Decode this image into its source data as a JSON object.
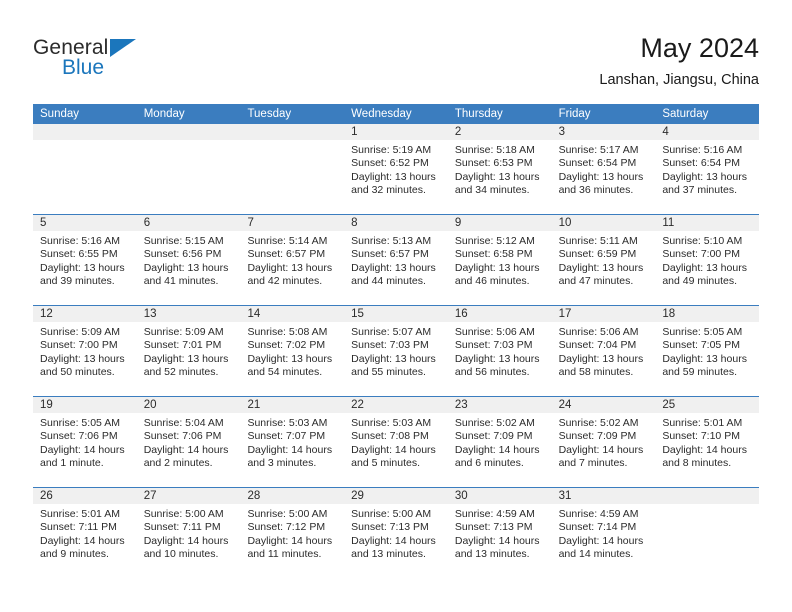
{
  "brand": {
    "name_part1": "General",
    "name_part2": "Blue",
    "accent_color": "#1b76bc",
    "logo_icon": "triangle-flag-icon"
  },
  "header": {
    "title": "May 2024",
    "subtitle": "Lanshan, Jiangsu, China"
  },
  "calendar": {
    "header_bg": "#3b7dbf",
    "daynum_bg": "#f0f0f0",
    "weekdays": [
      "Sunday",
      "Monday",
      "Tuesday",
      "Wednesday",
      "Thursday",
      "Friday",
      "Saturday"
    ],
    "weeks": [
      [
        {
          "day": "",
          "lines": []
        },
        {
          "day": "",
          "lines": []
        },
        {
          "day": "",
          "lines": []
        },
        {
          "day": "1",
          "lines": [
            "Sunrise: 5:19 AM",
            "Sunset: 6:52 PM",
            "Daylight: 13 hours",
            "and 32 minutes."
          ]
        },
        {
          "day": "2",
          "lines": [
            "Sunrise: 5:18 AM",
            "Sunset: 6:53 PM",
            "Daylight: 13 hours",
            "and 34 minutes."
          ]
        },
        {
          "day": "3",
          "lines": [
            "Sunrise: 5:17 AM",
            "Sunset: 6:54 PM",
            "Daylight: 13 hours",
            "and 36 minutes."
          ]
        },
        {
          "day": "4",
          "lines": [
            "Sunrise: 5:16 AM",
            "Sunset: 6:54 PM",
            "Daylight: 13 hours",
            "and 37 minutes."
          ]
        }
      ],
      [
        {
          "day": "5",
          "lines": [
            "Sunrise: 5:16 AM",
            "Sunset: 6:55 PM",
            "Daylight: 13 hours",
            "and 39 minutes."
          ]
        },
        {
          "day": "6",
          "lines": [
            "Sunrise: 5:15 AM",
            "Sunset: 6:56 PM",
            "Daylight: 13 hours",
            "and 41 minutes."
          ]
        },
        {
          "day": "7",
          "lines": [
            "Sunrise: 5:14 AM",
            "Sunset: 6:57 PM",
            "Daylight: 13 hours",
            "and 42 minutes."
          ]
        },
        {
          "day": "8",
          "lines": [
            "Sunrise: 5:13 AM",
            "Sunset: 6:57 PM",
            "Daylight: 13 hours",
            "and 44 minutes."
          ]
        },
        {
          "day": "9",
          "lines": [
            "Sunrise: 5:12 AM",
            "Sunset: 6:58 PM",
            "Daylight: 13 hours",
            "and 46 minutes."
          ]
        },
        {
          "day": "10",
          "lines": [
            "Sunrise: 5:11 AM",
            "Sunset: 6:59 PM",
            "Daylight: 13 hours",
            "and 47 minutes."
          ]
        },
        {
          "day": "11",
          "lines": [
            "Sunrise: 5:10 AM",
            "Sunset: 7:00 PM",
            "Daylight: 13 hours",
            "and 49 minutes."
          ]
        }
      ],
      [
        {
          "day": "12",
          "lines": [
            "Sunrise: 5:09 AM",
            "Sunset: 7:00 PM",
            "Daylight: 13 hours",
            "and 50 minutes."
          ]
        },
        {
          "day": "13",
          "lines": [
            "Sunrise: 5:09 AM",
            "Sunset: 7:01 PM",
            "Daylight: 13 hours",
            "and 52 minutes."
          ]
        },
        {
          "day": "14",
          "lines": [
            "Sunrise: 5:08 AM",
            "Sunset: 7:02 PM",
            "Daylight: 13 hours",
            "and 54 minutes."
          ]
        },
        {
          "day": "15",
          "lines": [
            "Sunrise: 5:07 AM",
            "Sunset: 7:03 PM",
            "Daylight: 13 hours",
            "and 55 minutes."
          ]
        },
        {
          "day": "16",
          "lines": [
            "Sunrise: 5:06 AM",
            "Sunset: 7:03 PM",
            "Daylight: 13 hours",
            "and 56 minutes."
          ]
        },
        {
          "day": "17",
          "lines": [
            "Sunrise: 5:06 AM",
            "Sunset: 7:04 PM",
            "Daylight: 13 hours",
            "and 58 minutes."
          ]
        },
        {
          "day": "18",
          "lines": [
            "Sunrise: 5:05 AM",
            "Sunset: 7:05 PM",
            "Daylight: 13 hours",
            "and 59 minutes."
          ]
        }
      ],
      [
        {
          "day": "19",
          "lines": [
            "Sunrise: 5:05 AM",
            "Sunset: 7:06 PM",
            "Daylight: 14 hours",
            "and 1 minute."
          ]
        },
        {
          "day": "20",
          "lines": [
            "Sunrise: 5:04 AM",
            "Sunset: 7:06 PM",
            "Daylight: 14 hours",
            "and 2 minutes."
          ]
        },
        {
          "day": "21",
          "lines": [
            "Sunrise: 5:03 AM",
            "Sunset: 7:07 PM",
            "Daylight: 14 hours",
            "and 3 minutes."
          ]
        },
        {
          "day": "22",
          "lines": [
            "Sunrise: 5:03 AM",
            "Sunset: 7:08 PM",
            "Daylight: 14 hours",
            "and 5 minutes."
          ]
        },
        {
          "day": "23",
          "lines": [
            "Sunrise: 5:02 AM",
            "Sunset: 7:09 PM",
            "Daylight: 14 hours",
            "and 6 minutes."
          ]
        },
        {
          "day": "24",
          "lines": [
            "Sunrise: 5:02 AM",
            "Sunset: 7:09 PM",
            "Daylight: 14 hours",
            "and 7 minutes."
          ]
        },
        {
          "day": "25",
          "lines": [
            "Sunrise: 5:01 AM",
            "Sunset: 7:10 PM",
            "Daylight: 14 hours",
            "and 8 minutes."
          ]
        }
      ],
      [
        {
          "day": "26",
          "lines": [
            "Sunrise: 5:01 AM",
            "Sunset: 7:11 PM",
            "Daylight: 14 hours",
            "and 9 minutes."
          ]
        },
        {
          "day": "27",
          "lines": [
            "Sunrise: 5:00 AM",
            "Sunset: 7:11 PM",
            "Daylight: 14 hours",
            "and 10 minutes."
          ]
        },
        {
          "day": "28",
          "lines": [
            "Sunrise: 5:00 AM",
            "Sunset: 7:12 PM",
            "Daylight: 14 hours",
            "and 11 minutes."
          ]
        },
        {
          "day": "29",
          "lines": [
            "Sunrise: 5:00 AM",
            "Sunset: 7:13 PM",
            "Daylight: 14 hours",
            "and 13 minutes."
          ]
        },
        {
          "day": "30",
          "lines": [
            "Sunrise: 4:59 AM",
            "Sunset: 7:13 PM",
            "Daylight: 14 hours",
            "and 13 minutes."
          ]
        },
        {
          "day": "31",
          "lines": [
            "Sunrise: 4:59 AM",
            "Sunset: 7:14 PM",
            "Daylight: 14 hours",
            "and 14 minutes."
          ]
        },
        {
          "day": "",
          "lines": []
        }
      ]
    ]
  }
}
